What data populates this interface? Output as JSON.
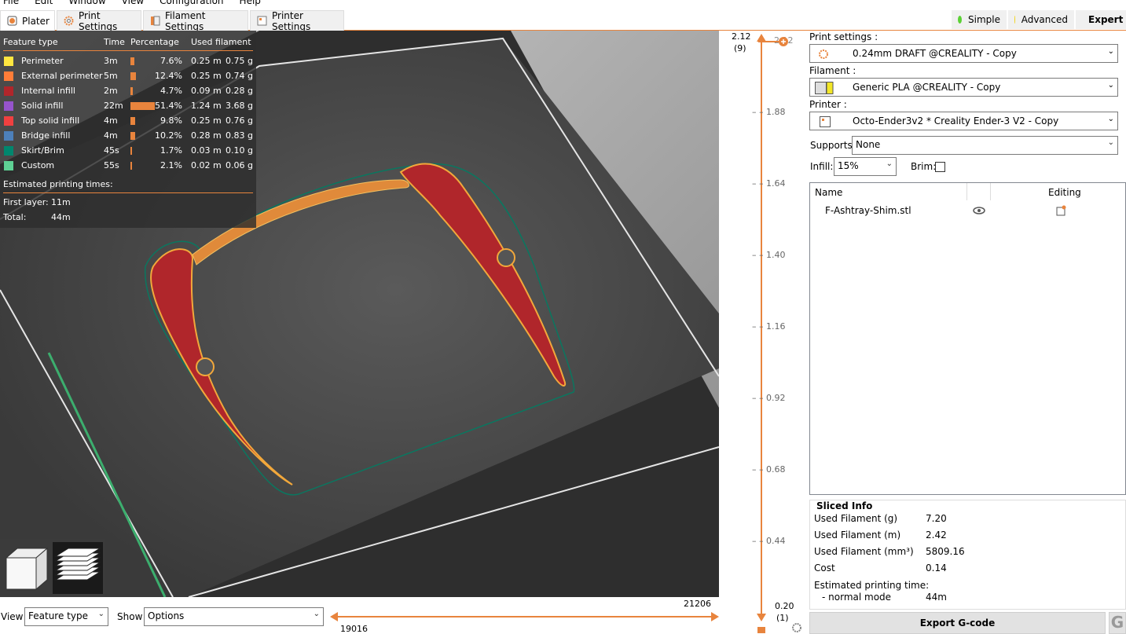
{
  "menu": {
    "file": "File",
    "edit": "Edit",
    "window": "Window",
    "view": "View",
    "configuration": "Configuration",
    "help": "Help"
  },
  "tabs": {
    "plater": "Plater",
    "print_settings": "Print Settings",
    "filament_settings": "Filament Settings",
    "printer_settings": "Printer Settings"
  },
  "modes": {
    "simple": "Simple",
    "advanced": "Advanced",
    "expert": "Expert"
  },
  "colors": {
    "accent": "#e8843d",
    "simple": "#5bd135",
    "advanced": "#f2d41b",
    "expert": "#e31a1a"
  },
  "legend": {
    "headers": {
      "feature": "Feature type",
      "time": "Time",
      "percentage": "Percentage",
      "used": "Used filament"
    },
    "rows": [
      {
        "name": "Perimeter",
        "time": "3m",
        "pct": "7.6%",
        "m": "0.25 m",
        "g": "0.75 g",
        "color": "#ffe640",
        "fraction": 0.076
      },
      {
        "name": "External perimeter",
        "time": "5m",
        "pct": "12.4%",
        "m": "0.25 m",
        "g": "0.74 g",
        "color": "#ff7d38",
        "fraction": 0.124
      },
      {
        "name": "Internal infill",
        "time": "2m",
        "pct": "4.7%",
        "m": "0.09 m",
        "g": "0.28 g",
        "color": "#b0262b",
        "fraction": 0.047
      },
      {
        "name": "Solid infill",
        "time": "22m",
        "pct": "51.4%",
        "m": "1.24 m",
        "g": "3.68 g",
        "color": "#9654cc",
        "fraction": 0.514
      },
      {
        "name": "Top solid infill",
        "time": "4m",
        "pct": "9.8%",
        "m": "0.25 m",
        "g": "0.76 g",
        "color": "#f04040",
        "fraction": 0.098
      },
      {
        "name": "Bridge infill",
        "time": "4m",
        "pct": "10.2%",
        "m": "0.28 m",
        "g": "0.83 g",
        "color": "#4d80ba",
        "fraction": 0.102
      },
      {
        "name": "Skirt/Brim",
        "time": "45s",
        "pct": "1.7%",
        "m": "0.03 m",
        "g": "0.10 g",
        "color": "#00876e",
        "fraction": 0.017
      },
      {
        "name": "Custom",
        "time": "55s",
        "pct": "2.1%",
        "m": "0.02 m",
        "g": "0.06 g",
        "color": "#5ed194",
        "fraction": 0.021
      }
    ],
    "est_title": "Estimated printing times:",
    "first_layer_label": "First layer:",
    "first_layer_value": "11m",
    "total_label": "Total:",
    "total_value": "44m"
  },
  "bottom": {
    "view_label": "View",
    "view_value": "Feature type",
    "show_label": "Show",
    "show_value": "Options",
    "hmax": "21206",
    "hmin": "19016"
  },
  "vslider": {
    "top_value": "2.12",
    "top_layer": "(9)",
    "top_right": "2.12",
    "ticks": [
      "1.88",
      "1.64",
      "1.40",
      "1.16",
      "0.92",
      "0.68",
      "0.44"
    ],
    "bottom_value": "0.20",
    "bottom_layer": "(1)"
  },
  "panel": {
    "print_label": "Print settings :",
    "print_value": "0.24mm DRAFT @CREALITY - Copy",
    "filament_label": "Filament :",
    "filament_value": "Generic PLA @CREALITY - Copy",
    "printer_label": "Printer :",
    "printer_value": "Octo-Ender3v2 * Creality Ender-3 V2 - Copy",
    "supports_label": "Supports:",
    "supports_value": "None",
    "infill_label": "Infill:",
    "infill_value": "15%",
    "brim_label": "Brim:",
    "col_name": "Name",
    "col_editing": "Editing",
    "object_name": "F-Ashtray-Shim.stl"
  },
  "sliced": {
    "title": "Sliced Info",
    "rows": [
      {
        "label": "Used Filament (g)",
        "value": "7.20"
      },
      {
        "label": "Used Filament (m)",
        "value": "2.42"
      },
      {
        "label": "Used Filament (mm³)",
        "value": "5809.16"
      },
      {
        "label": "Cost",
        "value": "0.14"
      }
    ],
    "est_label": "Estimated printing time:",
    "mode_label": "- normal mode",
    "mode_value": "44m",
    "export": "Export G-code"
  }
}
